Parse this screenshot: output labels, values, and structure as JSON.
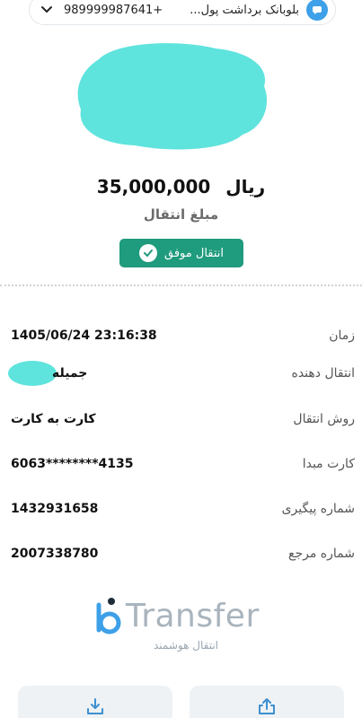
{
  "top_bar": {
    "phone": "989999987641+",
    "title": "بلوبانک برداشت پول...",
    "icons": [
      "chevron-down-icon",
      "chat-bubble-icon"
    ]
  },
  "transaction": {
    "amount": "35,000,000",
    "currency": "ریال",
    "amount_label": "مبلغ انتقال",
    "status": "انتقال موفق"
  },
  "details": [
    {
      "label": "زمان",
      "value": "1405/06/24 23:16:38"
    },
    {
      "label": "انتقال دهنده",
      "value": "جمیله"
    },
    {
      "label": "روش انتقال",
      "value": "کارت به کارت"
    },
    {
      "label": "کارت مبدا",
      "value": "6063********4135"
    },
    {
      "label": "شماره پیگیری",
      "value": "1432931658"
    },
    {
      "label": "شماره مرجع",
      "value": "2007338780"
    }
  ],
  "brand": {
    "name": "Transfer",
    "tagline": "انتقال هوشمند"
  },
  "actions": {
    "download_icon": "download-icon",
    "share_icon": "share-icon"
  },
  "colors": {
    "success": "#1f9b7d",
    "redaction": "#5fe3dd",
    "logo_blue": "#3da0e8"
  }
}
